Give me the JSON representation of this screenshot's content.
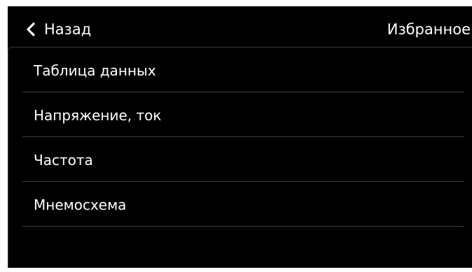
{
  "header": {
    "back_label": "Назад",
    "back_icon": "chevron-left-icon",
    "title": "Избранное"
  },
  "menu": {
    "items": [
      {
        "label": "Таблица данных"
      },
      {
        "label": "Напряжение, ток"
      },
      {
        "label": "Частота"
      },
      {
        "label": "Мнемосхема"
      }
    ]
  },
  "colors": {
    "background": "#000000",
    "text": "#ffffff",
    "divider": "#3e3e3e",
    "page": "#ffffff"
  }
}
